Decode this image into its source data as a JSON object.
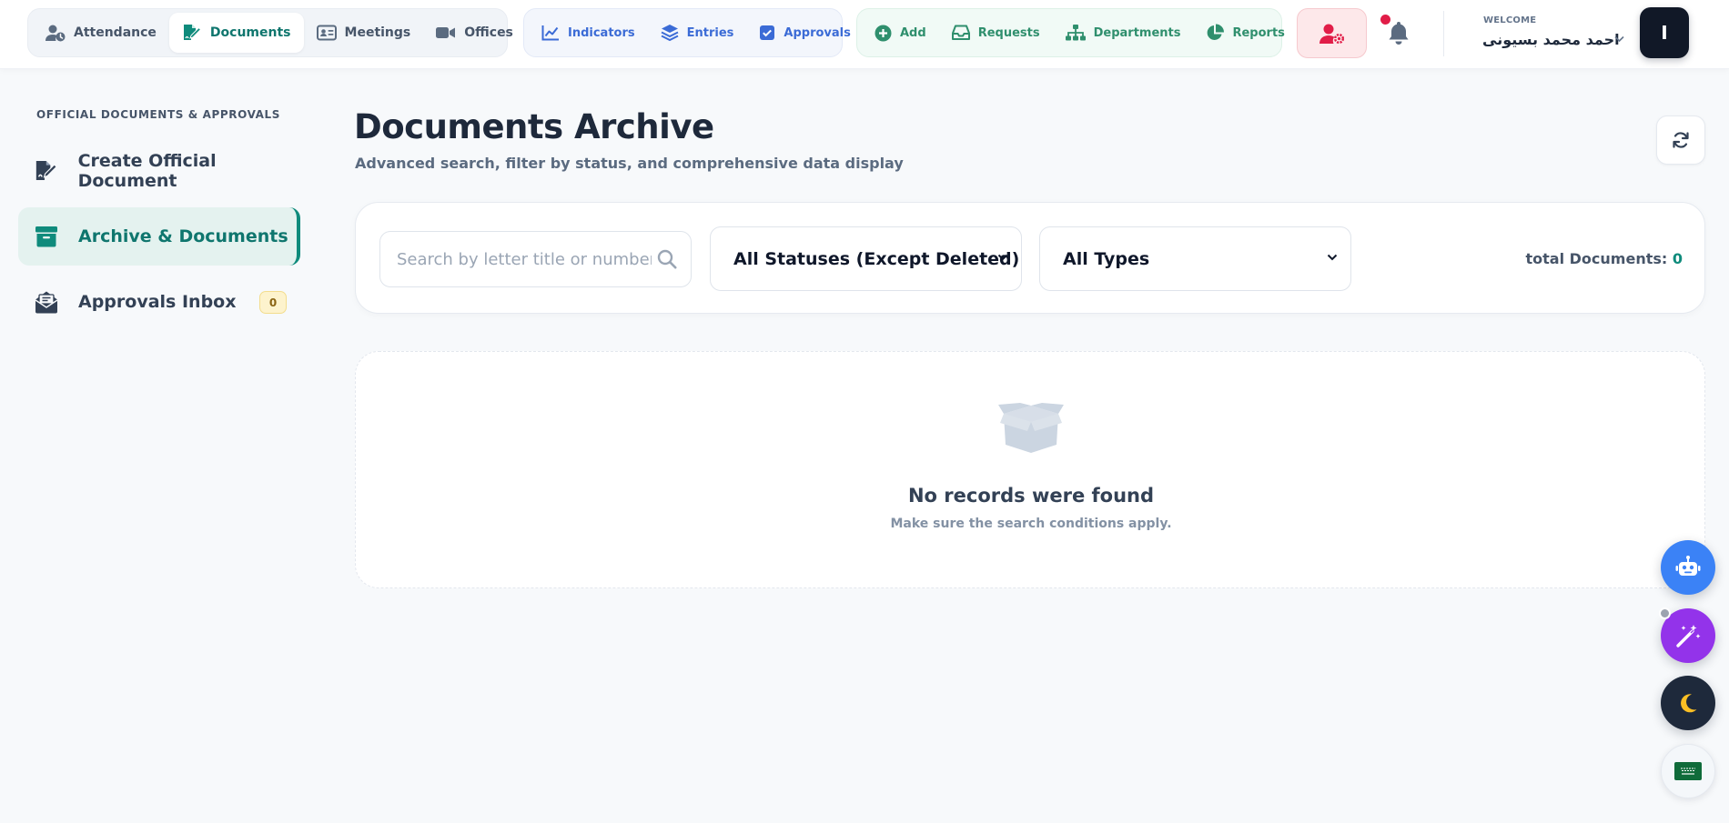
{
  "topnav": {
    "group1": [
      {
        "label": "Attendance",
        "icon": "user-clock-icon"
      },
      {
        "label": "Documents",
        "icon": "file-signature-icon",
        "active": true
      },
      {
        "label": "Meetings",
        "icon": "id-card-icon"
      },
      {
        "label": "Offices",
        "icon": "video-icon"
      }
    ],
    "group2": [
      {
        "label": "Indicators",
        "icon": "chart-line-icon"
      },
      {
        "label": "Entries",
        "icon": "layers-icon"
      },
      {
        "label": "Approvals",
        "icon": "check-square-icon"
      }
    ],
    "group3": [
      {
        "label": "Add",
        "icon": "plus-circle-icon"
      },
      {
        "label": "Requests",
        "icon": "inbox-icon"
      },
      {
        "label": "Departments",
        "icon": "sitemap-icon"
      },
      {
        "label": "Reports",
        "icon": "pie-chart-icon"
      }
    ]
  },
  "user": {
    "welcome_label": "WELCOME",
    "name": "احمد محمد بسيونى",
    "avatar_initial": "I"
  },
  "sidebar": {
    "title": "OFFICIAL DOCUMENTS & APPROVALS",
    "items": [
      {
        "label": "Create Official Document",
        "icon": "file-signature-icon"
      },
      {
        "label": "Archive & Documents",
        "icon": "archive-icon",
        "active": true
      },
      {
        "label": "Approvals Inbox",
        "icon": "envelope-open-icon",
        "badge": "0"
      }
    ]
  },
  "main": {
    "title": "Documents Archive",
    "subtitle": "Advanced search, filter by status, and comprehensive data display",
    "search": {
      "placeholder": "Search by letter title or number..."
    },
    "status_filter": {
      "selected": "All Statuses (Except Deleted)"
    },
    "type_filter": {
      "selected": "All Types"
    },
    "total": {
      "label": "total Documents:",
      "value": "0"
    },
    "empty": {
      "title": "No records were found",
      "subtitle": "Make sure the search conditions apply."
    }
  },
  "colors": {
    "accent": "#0f8b7c",
    "primary_text": "#1e293b",
    "bot_fab": "#3b82f6",
    "magic_fab": "#9333ea",
    "theme_fab": "#1e293b",
    "alert": "#e11d48"
  }
}
